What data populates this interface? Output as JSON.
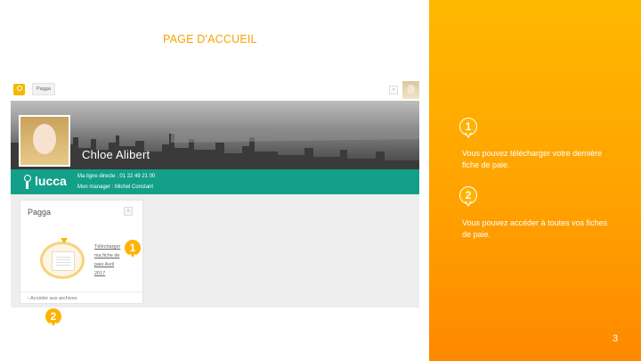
{
  "slide": {
    "title": "PAGE D'ACCUEIL",
    "page_number": "3"
  },
  "app": {
    "topbar": {
      "tab_label": "Pagga",
      "button_icon": "close-icon"
    },
    "profile": {
      "name": "Chloe Alibert"
    },
    "teal_bar": {
      "brand": "lucca",
      "direct_line": "Ma ligne directe : 01 22 49 21 00",
      "manager": "Mon manager : Michel Constant"
    },
    "card": {
      "title": "Pagga",
      "download_link": "Télécharger ma fiche de paie Avril 2017 ",
      "footer_link": "Accéder aux archives"
    }
  },
  "markers": [
    {
      "number": "1",
      "text": "Vous pouvez télécharger votre dernière fiche de paie."
    },
    {
      "number": "2",
      "text": "Vous pouvez accéder à toutes vos fiches de paie."
    }
  ],
  "colors": {
    "accent": "#f5a300",
    "teal": "#12a08a",
    "orange_panel": "#ffa200"
  }
}
